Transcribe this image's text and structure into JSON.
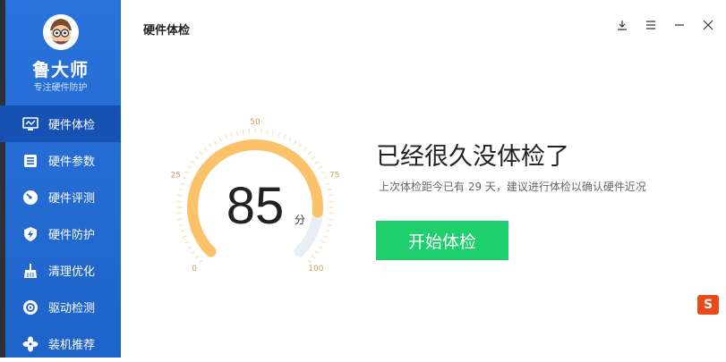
{
  "app": {
    "brand": "鲁大师",
    "slogan": "专注硬件防护",
    "page_title": "硬件体检"
  },
  "sidebar": {
    "items": [
      {
        "label": "硬件体检",
        "icon": "monitor-icon",
        "active": true
      },
      {
        "label": "硬件参数",
        "icon": "list-icon",
        "active": false
      },
      {
        "label": "硬件评测",
        "icon": "speedometer-icon",
        "active": false
      },
      {
        "label": "硬件防护",
        "icon": "shield-icon",
        "active": false
      },
      {
        "label": "清理优化",
        "icon": "broom-icon",
        "active": false
      },
      {
        "label": "驱动检测",
        "icon": "gear-icon",
        "active": false
      },
      {
        "label": "装机推荐",
        "icon": "fan-icon",
        "active": false
      }
    ]
  },
  "window": {
    "buttons": [
      "download-icon",
      "menu-icon",
      "minimize-icon",
      "close-icon"
    ]
  },
  "score": {
    "value": "85",
    "unit": "分",
    "ticks": [
      "0",
      "25",
      "50",
      "75",
      "100"
    ]
  },
  "status": {
    "headline": "已经很久没体检了",
    "detail": "上次体检距今已有 29 天，建议进行体检以确认硬件近况",
    "start_button": "开始体检"
  },
  "colors": {
    "sidebar": "#2a73dc",
    "active": "#1552b3",
    "gauge": "#fbc26a",
    "button": "#1fce6d"
  },
  "overlay": {
    "ime_badge": "S"
  }
}
